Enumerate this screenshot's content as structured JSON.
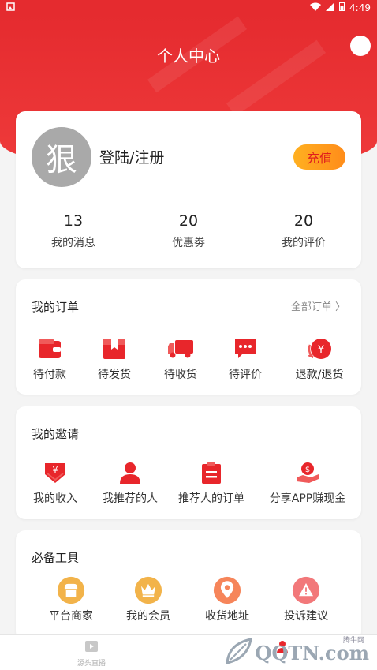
{
  "status_bar": {
    "time": "4:49"
  },
  "header": {
    "title": "个人中心"
  },
  "profile": {
    "avatar_char": "狠",
    "login_label": "登陆/注册",
    "recharge_label": "充值",
    "stats": [
      {
        "value": "13",
        "label": "我的消息"
      },
      {
        "value": "20",
        "label": "优惠劵"
      },
      {
        "value": "20",
        "label": "我的评价"
      }
    ]
  },
  "orders": {
    "title": "我的订单",
    "all_link": "全部订单 〉",
    "items": [
      {
        "label": "待付款",
        "icon": "wallet-icon"
      },
      {
        "label": "待发货",
        "icon": "package-icon"
      },
      {
        "label": "待收货",
        "icon": "truck-icon"
      },
      {
        "label": "待评价",
        "icon": "chat-icon"
      },
      {
        "label": "退款/退货",
        "icon": "refund-icon"
      }
    ]
  },
  "invite": {
    "title": "我的邀请",
    "items": [
      {
        "label": "我的收入",
        "icon": "income-icon"
      },
      {
        "label": "我推荐的人",
        "icon": "person-icon"
      },
      {
        "label": "推荐人的订单",
        "icon": "clipboard-icon"
      },
      {
        "label": "分享APP赚现金",
        "icon": "cash-hand-icon"
      }
    ]
  },
  "tools": {
    "title": "必备工具",
    "items": [
      {
        "label": "平台商家",
        "icon": "shop-icon"
      },
      {
        "label": "我的会员",
        "icon": "crown-icon"
      },
      {
        "label": "收货地址",
        "icon": "location-icon"
      },
      {
        "label": "投诉建议",
        "icon": "warning-icon"
      }
    ]
  },
  "bottom_nav": {
    "items": [
      {
        "label": "源头直播",
        "icon": "play-icon"
      }
    ]
  },
  "watermark": {
    "text": "QQTN.com",
    "small": "腾牛网"
  },
  "colors": {
    "primary": "#e52b2f",
    "accent_orange": "#ffa21a",
    "icon_red": "#e8262b",
    "tool_gold": "#f2b34a"
  }
}
